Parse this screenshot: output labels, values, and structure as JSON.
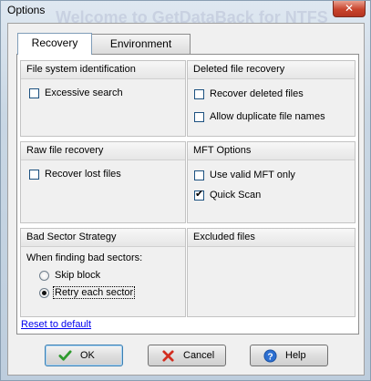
{
  "window": {
    "title": "Options",
    "close_label": "✕",
    "background_title": "Welcome to GetDataBack for NTFS"
  },
  "tabs": [
    {
      "label": "Recovery",
      "active": true
    },
    {
      "label": "Environment",
      "active": false
    }
  ],
  "groups": {
    "fs_identification": {
      "title": "File system identification",
      "options": [
        {
          "label": "Excessive search",
          "checked": false
        }
      ]
    },
    "deleted_recovery": {
      "title": "Deleted file recovery",
      "options": [
        {
          "label": "Recover deleted files",
          "checked": false
        },
        {
          "label": "Allow duplicate file names",
          "checked": false
        }
      ]
    },
    "raw_recovery": {
      "title": "Raw file recovery",
      "options": [
        {
          "label": "Recover lost files",
          "checked": false
        }
      ]
    },
    "mft_options": {
      "title": "MFT Options",
      "options": [
        {
          "label": "Use valid MFT only",
          "checked": false
        },
        {
          "label": "Quick Scan",
          "checked": true
        }
      ]
    },
    "bad_sector": {
      "title": "Bad Sector Strategy",
      "prompt": "When finding bad sectors:",
      "options": [
        {
          "label": "Skip block",
          "selected": false
        },
        {
          "label": "Retry each sector",
          "selected": true
        }
      ]
    },
    "excluded_files": {
      "title": "Excluded files"
    }
  },
  "reset_link": "Reset to default",
  "buttons": {
    "ok": "OK",
    "cancel": "Cancel",
    "help": "Help"
  },
  "colors": {
    "frame": "#cbd7e2",
    "link": "#0000ee",
    "ok_icon": "#2e9a2e",
    "cancel_icon": "#d22d1f",
    "help_icon": "#2c6fd1"
  }
}
